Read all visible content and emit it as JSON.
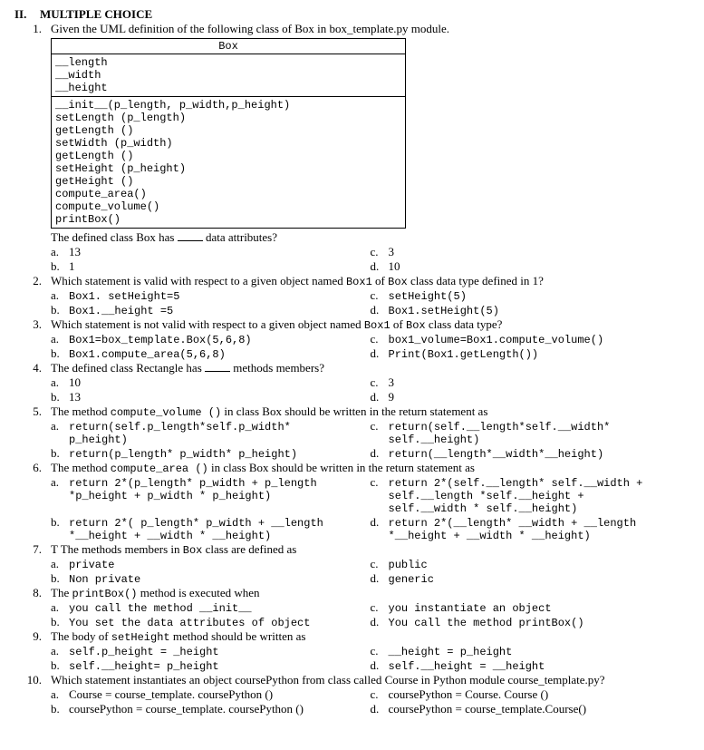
{
  "section": {
    "roman": "II.",
    "title": "MULTIPLE CHOICE"
  },
  "uml": {
    "title": "Box",
    "attrs": [
      "__length",
      "__width",
      "__height"
    ],
    "methods": [
      "__init__(p_length, p_width,p_height)",
      "setLength (p_length)",
      "getLength ()",
      "setWidth (p_width)",
      "getLength ()",
      "setHeight (p_height)",
      "getHeight ()",
      "compute_area()",
      "compute_volume()",
      "printBox()"
    ]
  },
  "q1": {
    "num": "1.",
    "stem": "Given the UML definition of the following class of Box in box_template.py module.",
    "sub": "The defined class Box has ____ data attributes?",
    "a": "13",
    "b": "1",
    "c": "3",
    "d": "10"
  },
  "q2": {
    "num": "2.",
    "stem": "Which statement is valid with respect to a given object named ",
    "stem_code1": "Box1",
    "stem_mid": " of ",
    "stem_code2": "Box",
    "stem_end": " class data type defined in 1?",
    "a": "Box1. setHeight=5",
    "b": "Box1.__height =5",
    "c": "setHeight(5)",
    "d": "Box1.setHeight(5)"
  },
  "q3": {
    "num": "3.",
    "stem": "Which statement is not valid with respect to a given object named ",
    "stem_code1": "Box1",
    "stem_mid": " of ",
    "stem_code2": "Box",
    "stem_end": " class data type?",
    "a": "Box1=box_template.Box(5,6,8)",
    "b": "Box1.compute_area(5,6,8)",
    "c": "box1_volume=Box1.compute_volume()",
    "d": "Print(Box1.getLength())"
  },
  "q4": {
    "num": "4.",
    "stem": "The defined class Rectangle has ____ methods members?",
    "a": "10",
    "b": "13",
    "c": "3",
    "d": "9"
  },
  "q5": {
    "num": "5.",
    "stem_pre": "The method ",
    "stem_code": "compute_volume ()",
    "stem_post": " in class Box should be written in the return statement as",
    "a1": "return(self.p_length*self.p_width*",
    "a2": "p_height)",
    "b": "return(p_length* p_width* p_height)",
    "c1": "return(self.__length*self.__width*",
    "c2": "self.__height)",
    "d": "return(__length*__width*__height)"
  },
  "q6": {
    "num": "6.",
    "stem_pre": "The method ",
    "stem_code": "compute_area ()",
    "stem_post": " in class Box should be written in the return statement as",
    "a1": "return 2*(p_length* p_width + p_length",
    "a2": "*p_height + p_width * p_height)",
    "b1": "return 2*( p_length* p_width + __length",
    "b2": "*__height + __width * __height)",
    "c1": "return 2*(self.__length* self.__width +",
    "c2": "self.__length *self.__height +",
    "c3": "self.__width * self.__height)",
    "d1": "return 2*(__length* __width + __length",
    "d2": "*__height + __width * __height)"
  },
  "q7": {
    "num": "7.",
    "stem_pre": "T  The methods members in ",
    "stem_code": "Box",
    "stem_post": " class are defined as",
    "a": "private",
    "b": "Non private",
    "c": "public",
    "d": "generic"
  },
  "q8": {
    "num": "8.",
    "stem_pre": "The ",
    "stem_code": "printBox()",
    "stem_post": " method is executed when",
    "a": "you call the method __init__",
    "b": "You set the data attributes of object",
    "c": "you instantiate an object",
    "d": "You call the method printBox()"
  },
  "q9": {
    "num": "9.",
    "stem_pre": "The body of ",
    "stem_code": "setHeight",
    "stem_post": " method should be written as",
    "a": "self.p_height = _height",
    "b": "self.__height= p_height",
    "c": "__height = p_height",
    "d": "self.__height = __height"
  },
  "q10": {
    "num": "10.",
    "stem": "Which statement instantiates an object coursePython from class called Course in Python module course_template.py?",
    "a": "Course = course_template. coursePython ()",
    "b": "coursePython = course_template. coursePython ()",
    "c": "coursePython = Course. Course ()",
    "d": "coursePython = course_template.Course()"
  },
  "labels": {
    "a": "a.",
    "b": "b.",
    "c": "c.",
    "d": "d."
  }
}
